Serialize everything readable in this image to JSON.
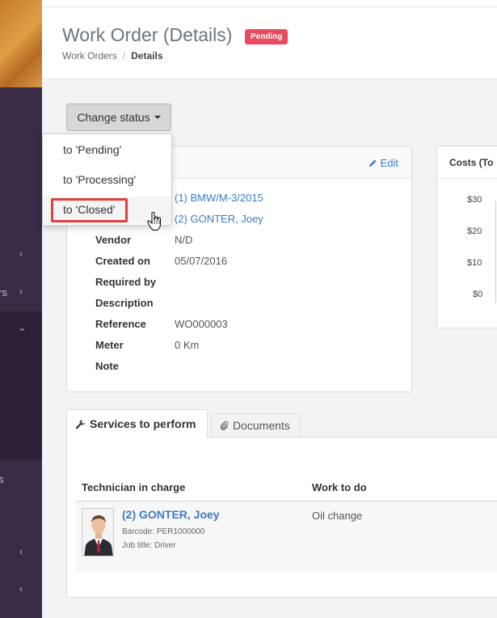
{
  "sidebar": {
    "partial_labels": [
      "rs",
      "s"
    ],
    "colors": {
      "bg": "#3a2c47",
      "active": "#2c1f37"
    }
  },
  "header": {
    "title": "Work Order (Details)",
    "status_badge": "Pending",
    "breadcrumb": {
      "parent": "Work Orders",
      "current": "Details"
    }
  },
  "toolbar": {
    "change_status_label": "Change status",
    "menu": [
      {
        "label": "to 'Pending'"
      },
      {
        "label": "to 'Processing'"
      },
      {
        "label": "to 'Closed'"
      }
    ]
  },
  "details": {
    "edit_label": "Edit",
    "asset": "(1) BMW/M-3/2015",
    "driver": "(2) GONTER, Joey",
    "fields": [
      {
        "label": "Vendor",
        "value": "N/D"
      },
      {
        "label": "Created on",
        "value": "05/07/2016"
      },
      {
        "label": "Required by",
        "value": ""
      },
      {
        "label": "Description",
        "value": ""
      },
      {
        "label": "Reference",
        "value": "WO000003"
      },
      {
        "label": "Meter",
        "value": "0 Km"
      },
      {
        "label": "Note",
        "value": ""
      }
    ]
  },
  "costs": {
    "title": "Costs (To",
    "ticks": [
      "$30",
      "$20",
      "$10",
      "$0"
    ]
  },
  "tabs": [
    {
      "label": "Services to perform",
      "icon": "wrench-icon",
      "active": true
    },
    {
      "label": "Documents",
      "icon": "paperclip-icon",
      "active": false
    }
  ],
  "services_table": {
    "headers": [
      "Technician in charge",
      "Work to do"
    ],
    "rows": [
      {
        "technician": "(2) GONTER, Joey",
        "barcode": "Barcode: PER1000000",
        "job_title": "Job title: Driver",
        "work": "Oil change"
      }
    ]
  },
  "colors": {
    "accent": "#3a7bc8",
    "badge": "#e74c5e",
    "highlight": "#e0403e"
  }
}
